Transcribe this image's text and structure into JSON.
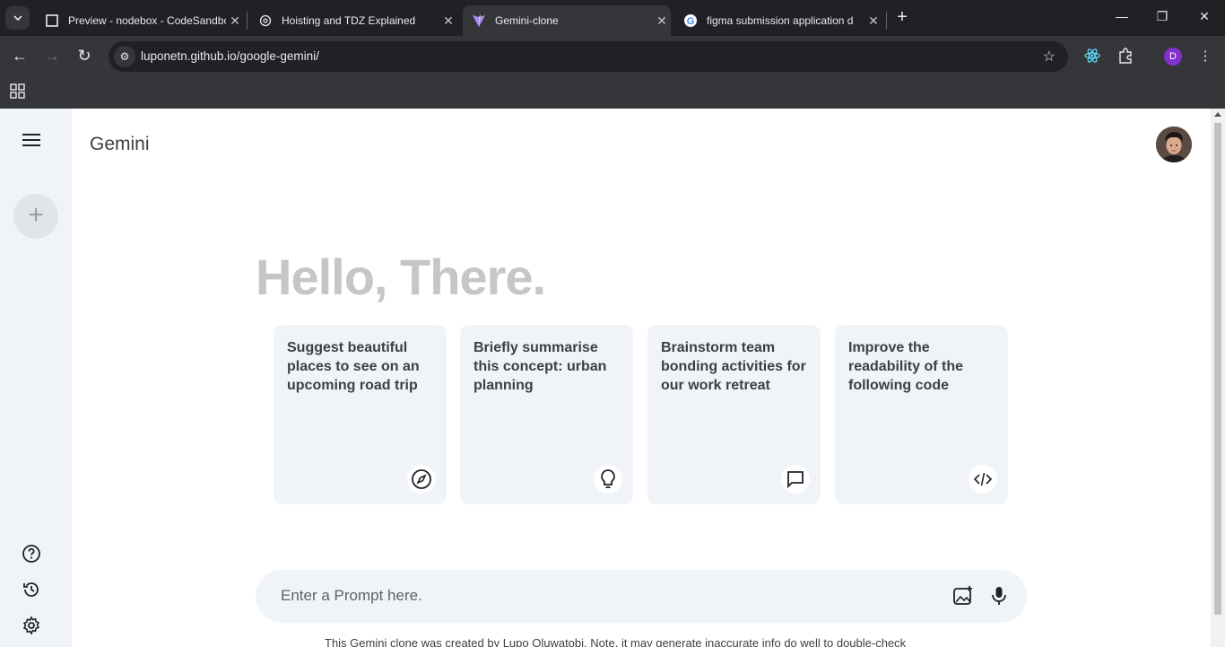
{
  "browser": {
    "tabs": [
      {
        "title": "Preview - nodebox - CodeSandbox",
        "active": false
      },
      {
        "title": "Hoisting and TDZ Explained",
        "active": false
      },
      {
        "title": "Gemini-clone",
        "active": true
      },
      {
        "title": "figma submission application d",
        "active": false
      }
    ],
    "url": "luponetn.github.io/google-gemini/",
    "profile_initial": "D"
  },
  "sidebar": {
    "menu_icon": "hamburger-icon",
    "new_chat_icon": "plus-icon",
    "bottom_items": [
      "help-icon",
      "history-icon",
      "settings-icon"
    ]
  },
  "main": {
    "brand": "Gemini",
    "greeting": "Hello, There.",
    "cards": [
      {
        "text": "Suggest beautiful places to see on an upcoming road trip",
        "icon": "compass-icon"
      },
      {
        "text": "Briefly summarise this concept: urban planning",
        "icon": "bulb-icon"
      },
      {
        "text": "Brainstorm team bonding activities for our work retreat",
        "icon": "message-icon"
      },
      {
        "text": "Improve the readability of the following code",
        "icon": "code-icon"
      }
    ],
    "prompt_placeholder": "Enter a Prompt here.",
    "footer_note": "This Gemini clone was created by Lupo Oluwatobi. Note, it may generate inaccurate info do well to double-check"
  }
}
